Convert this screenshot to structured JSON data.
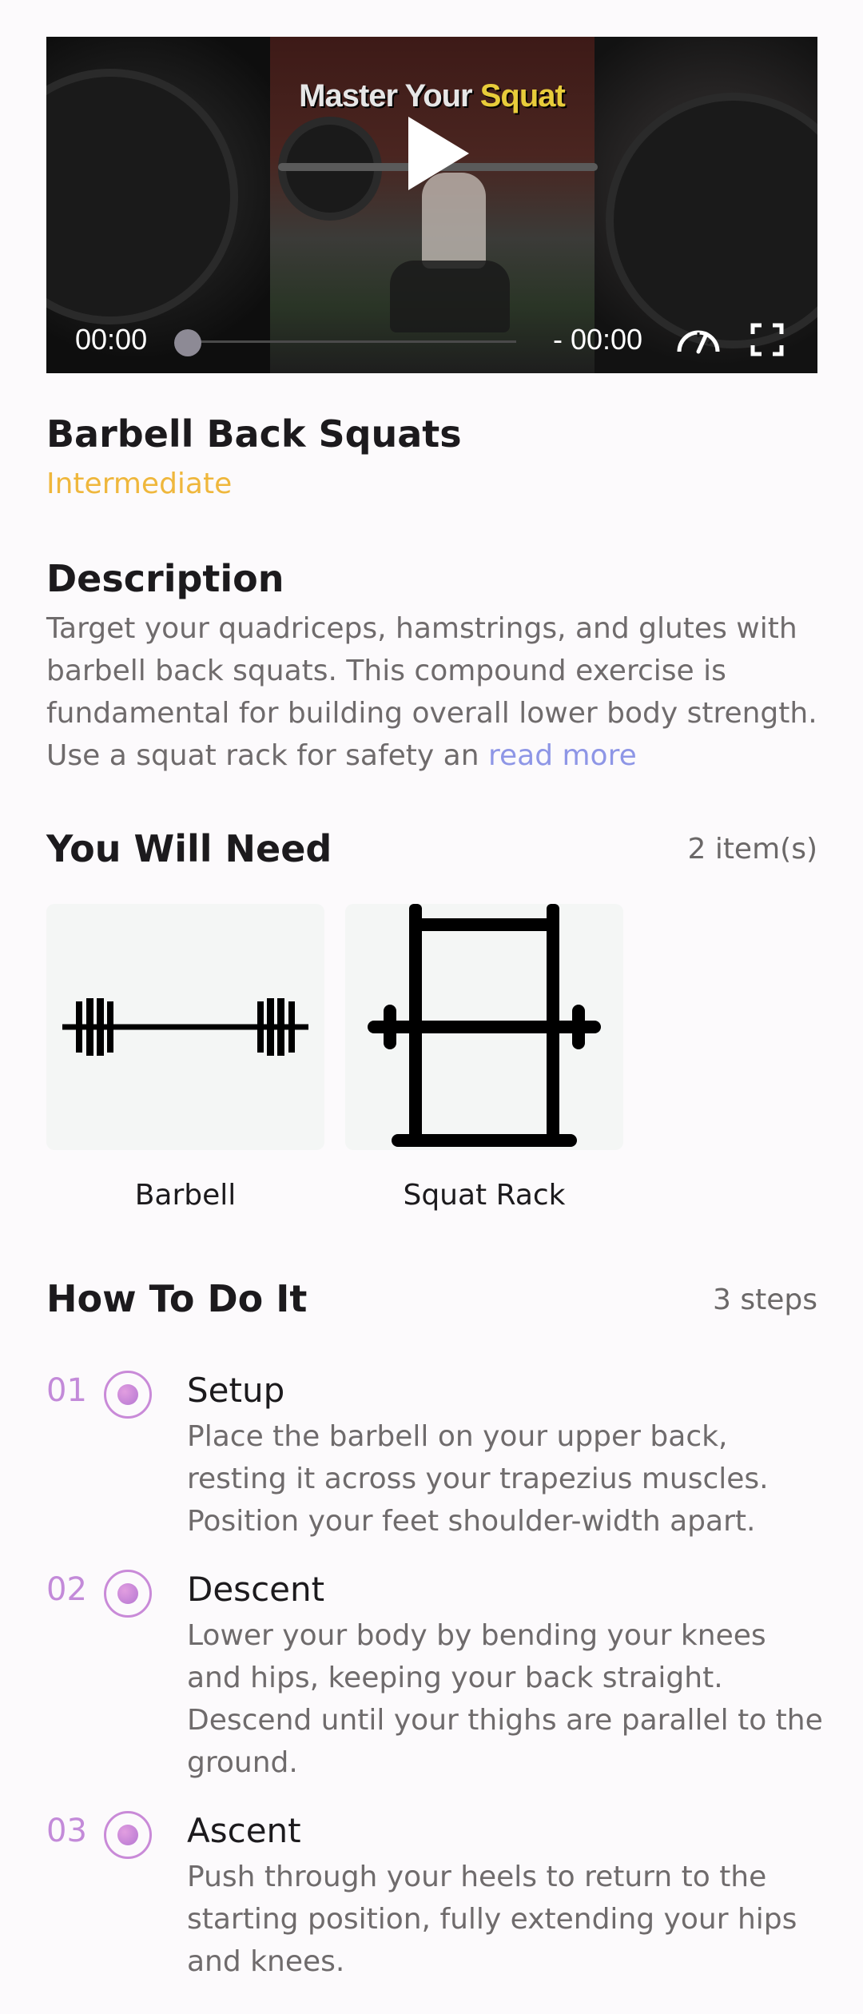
{
  "video": {
    "title_part1": "Master Your ",
    "title_part2": "Squat",
    "current_time": "00:00",
    "remaining_time": "- 00:00",
    "play_icon": "play-icon",
    "speed_icon": "speedometer-icon",
    "fullscreen_icon": "fullscreen-icon",
    "progress": 0
  },
  "exercise": {
    "name": "Barbell Back Squats",
    "level": "Intermediate",
    "level_color": "#efb73c"
  },
  "description": {
    "heading": "Description",
    "text": "Target your quadriceps, hamstrings, and glutes with barbell back squats. This compound exercise is fundamental for building overall lower body strength. Use a squat rack for safety an ",
    "read_more": "read more"
  },
  "equipment": {
    "heading": "You Will Need",
    "count": "2 item(s)",
    "items": [
      {
        "label": "Barbell",
        "icon": "barbell-icon"
      },
      {
        "label": "Squat Rack",
        "icon": "squat-rack-icon"
      }
    ]
  },
  "steps": {
    "heading": "How To Do It",
    "count": "3 steps",
    "items": [
      {
        "num": "01",
        "title": "Setup",
        "text": "Place the barbell on your upper back, resting it across your trapezius muscles. Position your feet shoulder-width apart."
      },
      {
        "num": "02",
        "title": "Descent",
        "text": "Lower your body by bending your knees and hips, keeping your back straight. Descend until your thighs are parallel to the ground."
      },
      {
        "num": "03",
        "title": "Ascent",
        "text": "Push through your heels to return to the starting position, fully extending your hips and knees."
      }
    ]
  },
  "colors": {
    "accent_purple": "#c38ad9",
    "link": "#8e96e6",
    "background": "#fcfafc"
  }
}
